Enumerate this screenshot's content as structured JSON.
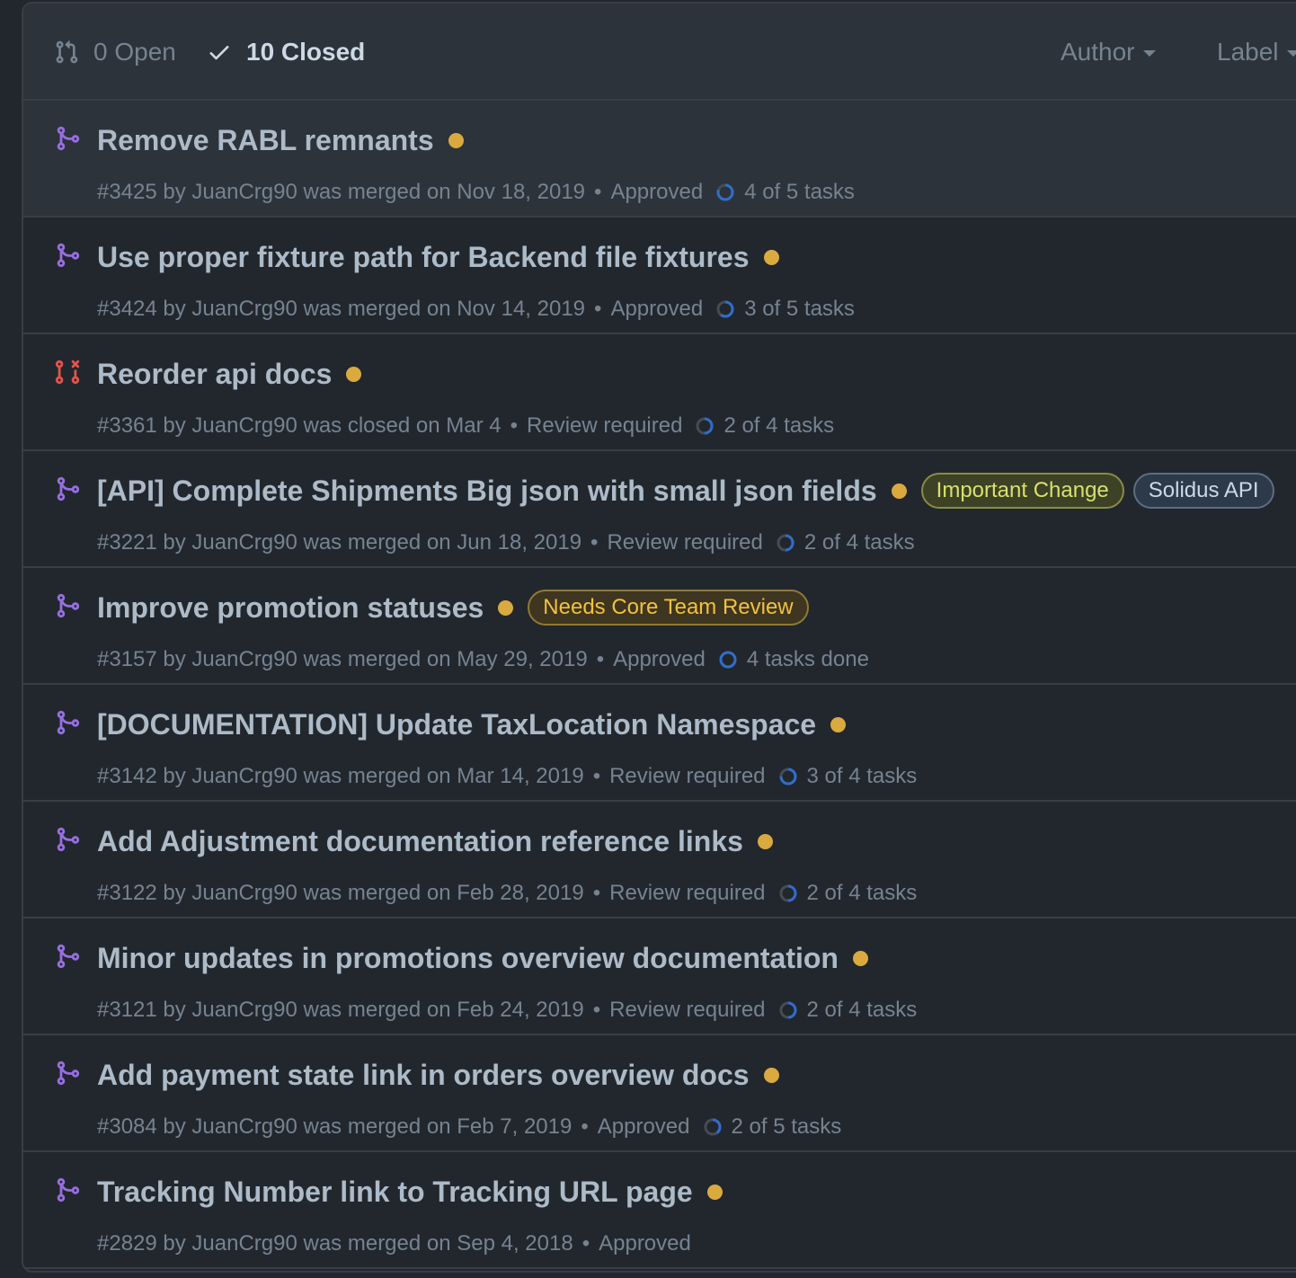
{
  "header": {
    "open_label": "0 Open",
    "closed_label": "10 Closed",
    "author_label": "Author",
    "label_label": "Label"
  },
  "colors": {
    "merged": "#986ee2",
    "closed": "#e5534b",
    "dot": "#daaa3f",
    "ring": "#316dca"
  },
  "pull_requests": [
    {
      "title": "Remove RABL remnants",
      "state": "merged",
      "meta": "#3425 by JuanCrg90 was merged on Nov 18, 2019",
      "review": "Approved",
      "tasks": "4 of 5 tasks",
      "task_progress": 0.8,
      "labels": []
    },
    {
      "title": "Use proper fixture path for Backend file fixtures",
      "state": "merged",
      "meta": "#3424 by JuanCrg90 was merged on Nov 14, 2019",
      "review": "Approved",
      "tasks": "3 of 5 tasks",
      "task_progress": 0.6,
      "labels": []
    },
    {
      "title": "Reorder api docs",
      "state": "closed",
      "meta": "#3361 by JuanCrg90 was closed on Mar 4",
      "review": "Review required",
      "tasks": "2 of 4 tasks",
      "task_progress": 0.5,
      "labels": []
    },
    {
      "title": "[API] Complete Shipments Big json with small json fields",
      "state": "merged",
      "meta": "#3221 by JuanCrg90 was merged on Jun 18, 2019",
      "review": "Review required",
      "tasks": "2 of 4 tasks",
      "task_progress": 0.5,
      "labels": [
        {
          "text": "Important Change",
          "fg": "#d7e26b",
          "bg": "#3d4126",
          "border": "#878d44"
        },
        {
          "text": "Solidus API",
          "fg": "#cdd9e5",
          "bg": "#2d3a4a",
          "border": "#5c6e82"
        }
      ]
    },
    {
      "title": "Improve promotion statuses",
      "state": "merged",
      "meta": "#3157 by JuanCrg90 was merged on May 29, 2019",
      "review": "Approved",
      "tasks": "4 tasks done",
      "task_progress": 1.0,
      "labels": [
        {
          "text": "Needs Core Team Review",
          "fg": "#f3c13f",
          "bg": "#3e3620",
          "border": "#8f7a35"
        }
      ]
    },
    {
      "title": "[DOCUMENTATION] Update TaxLocation Namespace",
      "state": "merged",
      "meta": "#3142 by JuanCrg90 was merged on Mar 14, 2019",
      "review": "Review required",
      "tasks": "3 of 4 tasks",
      "task_progress": 0.75,
      "labels": []
    },
    {
      "title": "Add Adjustment documentation reference links",
      "state": "merged",
      "meta": "#3122 by JuanCrg90 was merged on Feb 28, 2019",
      "review": "Review required",
      "tasks": "2 of 4 tasks",
      "task_progress": 0.5,
      "labels": []
    },
    {
      "title": "Minor updates in promotions overview documentation",
      "state": "merged",
      "meta": "#3121 by JuanCrg90 was merged on Feb 24, 2019",
      "review": "Review required",
      "tasks": "2 of 4 tasks",
      "task_progress": 0.5,
      "labels": []
    },
    {
      "title": "Add payment state link in orders overview docs",
      "state": "merged",
      "meta": "#3084 by JuanCrg90 was merged on Feb 7, 2019",
      "review": "Approved",
      "tasks": "2 of 5 tasks",
      "task_progress": 0.4,
      "labels": []
    },
    {
      "title": "Tracking Number link to Tracking URL page",
      "state": "merged",
      "meta": "#2829 by JuanCrg90 was merged on Sep 4, 2018",
      "review": "Approved",
      "tasks": "",
      "task_progress": null,
      "labels": []
    }
  ]
}
